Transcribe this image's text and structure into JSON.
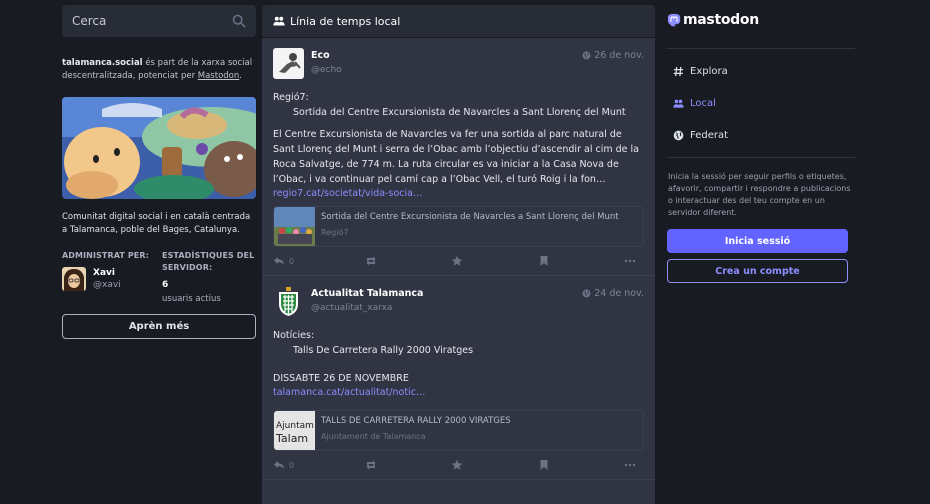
{
  "search": {
    "placeholder": "Cerca"
  },
  "server": {
    "domain": "talamanca.social",
    "about_mid": " és part de la xarxa social descentralitzada, potenciat per ",
    "mastodon_link": "Mastodon",
    "about_end": ".",
    "description": "Comunitat digital social i en català centrada a Talamanca, poble del Bages, Catalunya.",
    "admin_heading": "ADMINISTRAT PER:",
    "stats_heading": "ESTADÍSTIQUES DEL SERVIDOR:",
    "admin_name": "Xavi",
    "admin_acct": "@xavi",
    "active_users": "6",
    "active_users_label": "usuaris actius",
    "learn_more": "Aprèn més"
  },
  "timeline": {
    "title": "Línia de temps local",
    "statuses": [
      {
        "name": "Eco",
        "acct": "@echo",
        "time": "26 de nov.",
        "line1": "Regió7:",
        "line2": "Sortida del Centre Excursionista de Navarcles   a Sant Llorenç del Munt",
        "body": "El Centre Excursionista de Navarcles va fer una sortida al parc natural de Sant Llorenç del Munt i serra de l’Obac amb l’objectiu d’ascendir al cim de la Roca Salvatge, de 774 m. La ruta circular es va iniciar a la Casa Nova de l’Obac, i va continuar pel camí cap a l’Obac Vell, el turó Roig i la fon…",
        "link": "regio7.cat/societat/vida-socia…",
        "card_title": "Sortida del Centre Excursionista de Navarcles a Sant Llorenç del Munt",
        "card_sub": "Regió7",
        "replies": "0"
      },
      {
        "name": "Actualitat Talamanca",
        "acct": "@actualitat_xarxa",
        "time": "24 de nov.",
        "line1": "Notícies:",
        "line2": "Talls De Carretera Rally 2000 Viratges",
        "body": "DISSABTE 26 DE NOVEMBRE",
        "link": "talamanca.cat/actualitat/notic…",
        "card_title": "TALLS DE CARRETERA RALLY 2000 VIRATGES",
        "card_sub": "Ajuntament de Talamanca",
        "card_thumb_text_1": "Ajuntam",
        "card_thumb_text_2": "Talam",
        "replies": "0"
      }
    ]
  },
  "nav": {
    "logo": "mastodon",
    "explore": "Explora",
    "local": "Local",
    "federated": "Federat"
  },
  "signin": {
    "text": "Inicia la sessió per seguir perfils o etiquetes, afavorir, compartir i respondre a publicacions o interactuar des del teu compte en un servidor diferent.",
    "login": "Inicia sessió",
    "register": "Crea un compte"
  },
  "colors": {
    "accent": "#6364ff",
    "link": "#8c8dff",
    "bg": "#191b22",
    "panel": "#282c37",
    "feed": "#313543"
  }
}
